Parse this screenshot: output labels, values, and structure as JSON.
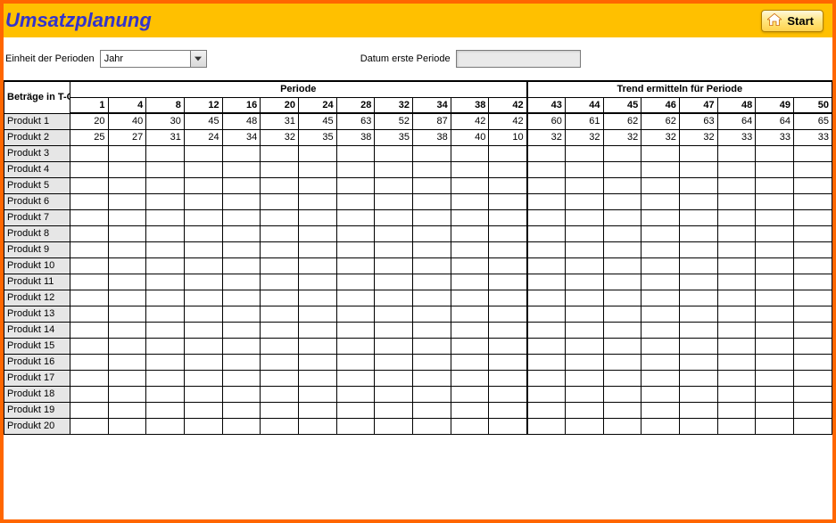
{
  "header": {
    "title": "Umsatzplanung",
    "start_label": "Start"
  },
  "controls": {
    "unit_label": "Einheit der Perioden",
    "unit_value": "Jahr",
    "date_label": "Datum erste Periode",
    "date_value": ""
  },
  "table": {
    "periode_label": "Periode",
    "trend_label": "Trend ermitteln für Periode",
    "betraege_label": "Beträge in T-CHF",
    "periode_cols": [
      "1",
      "4",
      "8",
      "12",
      "16",
      "20",
      "24",
      "28",
      "32",
      "34",
      "38",
      "42"
    ],
    "trend_cols": [
      "43",
      "44",
      "45",
      "46",
      "47",
      "48",
      "49",
      "50"
    ],
    "rows": [
      {
        "label": "Produkt 1",
        "periode": [
          "20",
          "40",
          "30",
          "45",
          "48",
          "31",
          "45",
          "63",
          "52",
          "87",
          "42",
          "42"
        ],
        "trend": [
          "60",
          "61",
          "62",
          "62",
          "63",
          "64",
          "64",
          "65"
        ]
      },
      {
        "label": "Produkt 2",
        "periode": [
          "25",
          "27",
          "31",
          "24",
          "34",
          "32",
          "35",
          "38",
          "35",
          "38",
          "40",
          "10"
        ],
        "trend": [
          "32",
          "32",
          "32",
          "32",
          "32",
          "33",
          "33",
          "33"
        ]
      },
      {
        "label": "Produkt 3"
      },
      {
        "label": "Produkt 4"
      },
      {
        "label": "Produkt 5"
      },
      {
        "label": "Produkt 6"
      },
      {
        "label": "Produkt 7"
      },
      {
        "label": "Produkt 8"
      },
      {
        "label": "Produkt 9"
      },
      {
        "label": "Produkt 10"
      },
      {
        "label": "Produkt 11"
      },
      {
        "label": "Produkt 12"
      },
      {
        "label": "Produkt 13"
      },
      {
        "label": "Produkt 14"
      },
      {
        "label": "Produkt 15"
      },
      {
        "label": "Produkt 16"
      },
      {
        "label": "Produkt 17"
      },
      {
        "label": "Produkt 18"
      },
      {
        "label": "Produkt 19"
      },
      {
        "label": "Produkt 20"
      }
    ]
  }
}
